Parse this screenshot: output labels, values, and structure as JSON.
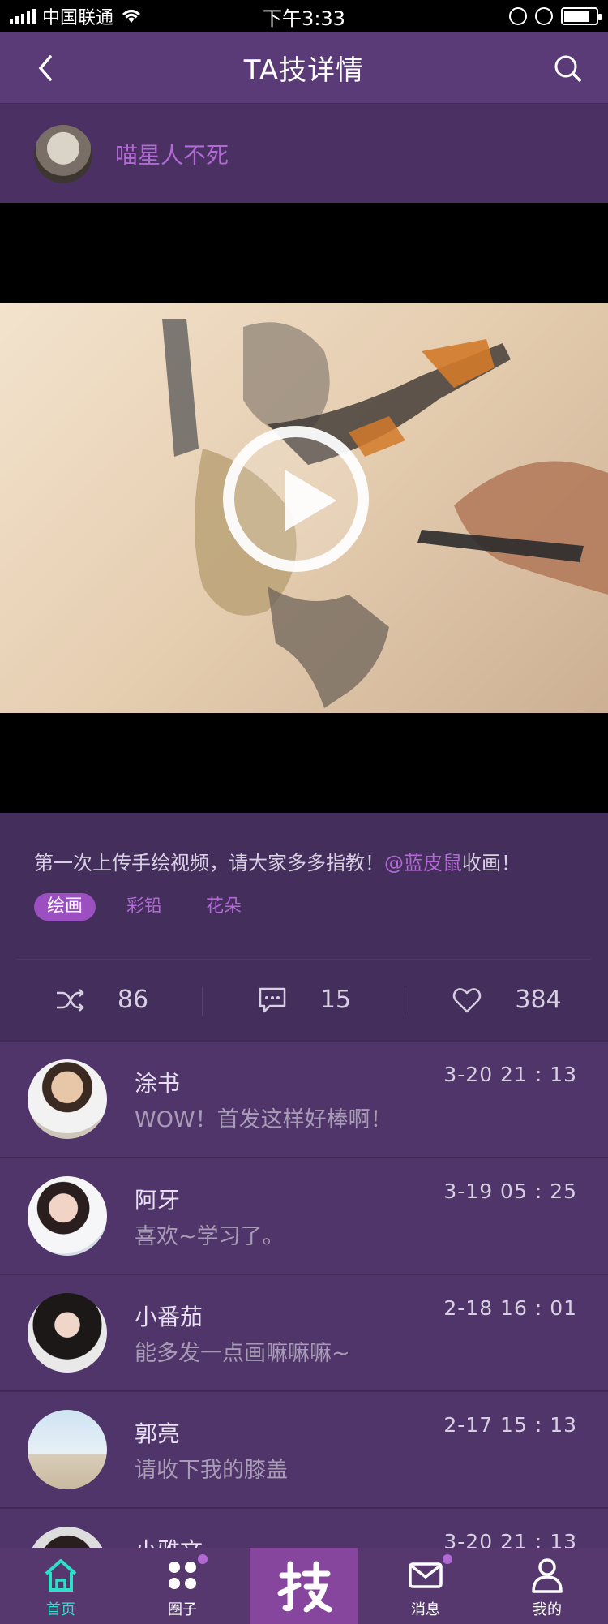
{
  "status_bar": {
    "carrier": "中国联通",
    "time": "下午3:33",
    "battery_level": 0.8
  },
  "nav": {
    "title": "TA技详情",
    "back_icon": "chevron-left-icon",
    "search_icon": "search-icon"
  },
  "author": {
    "name": "喵星人不死"
  },
  "post": {
    "description_prefix": "第一次上传手绘视频，请大家多多指教！",
    "mention": "@蓝皮鼠",
    "description_suffix": "收画！",
    "tags": [
      "绘画",
      "彩铅",
      "花朵"
    ],
    "stats": {
      "shares": "86",
      "comments": "15",
      "likes": "384"
    }
  },
  "comments": [
    {
      "name": "涂书",
      "text": "WOW！首发这样好棒啊！",
      "time": "3-20  21 : 13"
    },
    {
      "name": "阿牙",
      "text": "喜欢~学习了。",
      "time": "3-19  05 : 25"
    },
    {
      "name": "小番茄",
      "text": "能多发一点画嘛嘛嘛~",
      "time": "2-18  16 : 01"
    },
    {
      "name": "郭亮",
      "text": "请收下我的膝盖",
      "time": "2-17  15 : 13"
    },
    {
      "name": "小雅文",
      "text": "",
      "time": "3-20  21 : 13"
    }
  ],
  "tab_bar": {
    "items": [
      {
        "label": "首页",
        "icon": "home-icon"
      },
      {
        "label": "圈子",
        "icon": "circles-icon"
      },
      {
        "label": "",
        "icon": "ji-logo-icon"
      },
      {
        "label": "消息",
        "icon": "mail-icon"
      },
      {
        "label": "我的",
        "icon": "user-icon"
      }
    ]
  },
  "colors": {
    "accent": "#b169d3",
    "nav_bg": "#5b3a78",
    "active_tab": "#2de0c8"
  }
}
